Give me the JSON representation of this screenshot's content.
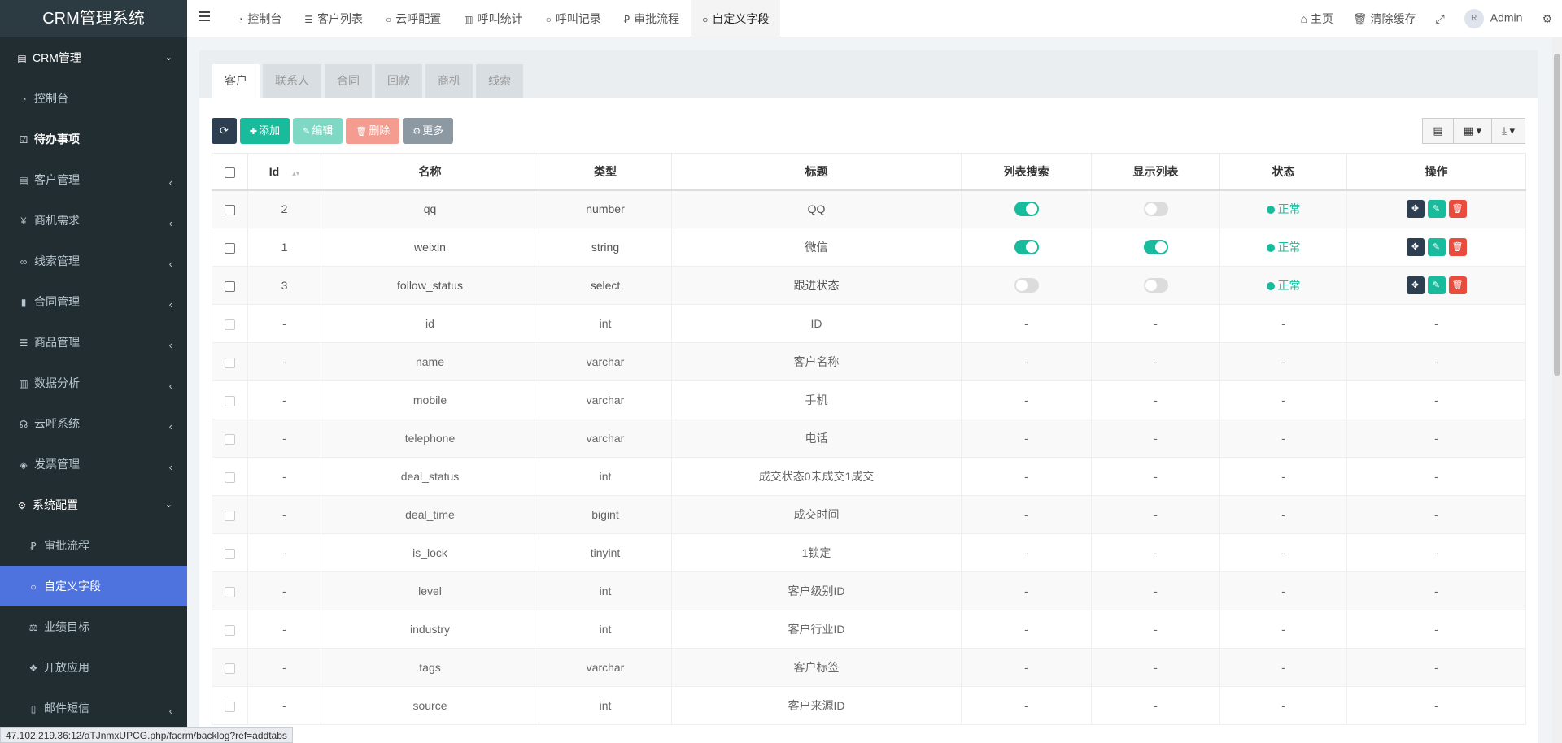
{
  "app": {
    "title": "CRM管理系统"
  },
  "sidebar": {
    "items": [
      {
        "label": "CRM管理",
        "type": "group",
        "icon": "id-card-icon",
        "glyph": "▤",
        "arrow": "⌄"
      },
      {
        "label": "控制台",
        "type": "item",
        "icon": "dashboard-icon",
        "glyph": "◔"
      },
      {
        "label": "待办事项",
        "type": "item-bold",
        "icon": "calendar-check-icon",
        "glyph": "☑"
      },
      {
        "label": "客户管理",
        "type": "item",
        "icon": "address-card-icon",
        "glyph": "▤",
        "arrow": "‹"
      },
      {
        "label": "商机需求",
        "type": "item",
        "icon": "yen-icon",
        "glyph": "¥",
        "arrow": "‹"
      },
      {
        "label": "线索管理",
        "type": "item",
        "icon": "link-icon",
        "glyph": "∞",
        "arrow": "‹"
      },
      {
        "label": "合同管理",
        "type": "item",
        "icon": "bookmark-icon",
        "glyph": "▮",
        "arrow": "‹"
      },
      {
        "label": "商品管理",
        "type": "item",
        "icon": "list-icon",
        "glyph": "☰",
        "arrow": "‹"
      },
      {
        "label": "数据分析",
        "type": "item",
        "icon": "bar-chart-icon",
        "glyph": "▥",
        "arrow": "‹"
      },
      {
        "label": "云呼系统",
        "type": "item",
        "icon": "headphones-icon",
        "glyph": "☊",
        "arrow": "‹"
      },
      {
        "label": "发票管理",
        "type": "item",
        "icon": "tag-icon",
        "glyph": "◈",
        "arrow": "‹"
      },
      {
        "label": "系统配置",
        "type": "group-bold",
        "icon": "cogs-icon",
        "glyph": "⚙",
        "arrow": "⌄"
      },
      {
        "label": "审批流程",
        "type": "sub",
        "icon": "flow-icon",
        "glyph": "Ꝑ"
      },
      {
        "label": "自定义字段",
        "type": "sub-active",
        "icon": "circle-icon",
        "glyph": "○"
      },
      {
        "label": "业绩目标",
        "type": "sub",
        "icon": "balance-scale-icon",
        "glyph": "⚖"
      },
      {
        "label": "开放应用",
        "type": "sub",
        "icon": "cubes-icon",
        "glyph": "❖"
      },
      {
        "label": "邮件短信",
        "type": "sub",
        "icon": "columns-icon",
        "glyph": "▯",
        "arrow": "‹"
      }
    ]
  },
  "topbar": {
    "tabs": [
      {
        "label": "控制台",
        "icon": "dashboard-icon",
        "glyph": "◔"
      },
      {
        "label": "客户列表",
        "icon": "list-icon",
        "glyph": "☰"
      },
      {
        "label": "云呼配置",
        "icon": "circle-icon",
        "glyph": "○"
      },
      {
        "label": "呼叫统计",
        "icon": "bar-chart-icon",
        "glyph": "▥"
      },
      {
        "label": "呼叫记录",
        "icon": "circle-icon",
        "glyph": "○"
      },
      {
        "label": "审批流程",
        "icon": "flow-icon",
        "glyph": "Ꝑ"
      },
      {
        "label": "自定义字段",
        "icon": "circle-icon",
        "glyph": "○",
        "active": true
      }
    ],
    "home_label": "主页",
    "clear_cache_label": "清除缓存",
    "user_name": "Admin",
    "avatar_text": "R"
  },
  "subtabs": [
    "客户",
    "联系人",
    "合同",
    "回款",
    "商机",
    "线索"
  ],
  "toolbar": {
    "add_label": "添加",
    "edit_label": "编辑",
    "delete_label": "删除",
    "more_label": "更多"
  },
  "table": {
    "headers": [
      "Id",
      "名称",
      "类型",
      "标题",
      "列表搜索",
      "显示列表",
      "状态",
      "操作"
    ],
    "custom_rows": [
      {
        "id": "2",
        "name": "qq",
        "type": "number",
        "title": "QQ",
        "search": true,
        "show": false,
        "status": "正常"
      },
      {
        "id": "1",
        "name": "weixin",
        "type": "string",
        "title": "微信",
        "search": true,
        "show": true,
        "status": "正常"
      },
      {
        "id": "3",
        "name": "follow_status",
        "type": "select",
        "title": "跟进状态",
        "search": false,
        "show": false,
        "status": "正常"
      }
    ],
    "system_rows": [
      {
        "id": "-",
        "name": "id",
        "type": "int",
        "title": "ID",
        "search": "-",
        "show": "-",
        "status": "-",
        "ops": "-"
      },
      {
        "id": "-",
        "name": "name",
        "type": "varchar",
        "title": "客户名称",
        "search": "-",
        "show": "-",
        "status": "-",
        "ops": "-"
      },
      {
        "id": "-",
        "name": "mobile",
        "type": "varchar",
        "title": "手机",
        "search": "-",
        "show": "-",
        "status": "-",
        "ops": "-"
      },
      {
        "id": "-",
        "name": "telephone",
        "type": "varchar",
        "title": "电话",
        "search": "-",
        "show": "-",
        "status": "-",
        "ops": "-"
      },
      {
        "id": "-",
        "name": "deal_status",
        "type": "int",
        "title": "成交状态0未成交1成交",
        "search": "-",
        "show": "-",
        "status": "-",
        "ops": "-"
      },
      {
        "id": "-",
        "name": "deal_time",
        "type": "bigint",
        "title": "成交时间",
        "search": "-",
        "show": "-",
        "status": "-",
        "ops": "-"
      },
      {
        "id": "-",
        "name": "is_lock",
        "type": "tinyint",
        "title": "1锁定",
        "search": "-",
        "show": "-",
        "status": "-",
        "ops": "-"
      },
      {
        "id": "-",
        "name": "level",
        "type": "int",
        "title": "客户级别ID",
        "search": "-",
        "show": "-",
        "status": "-",
        "ops": "-"
      },
      {
        "id": "-",
        "name": "industry",
        "type": "int",
        "title": "客户行业ID",
        "search": "-",
        "show": "-",
        "status": "-",
        "ops": "-"
      },
      {
        "id": "-",
        "name": "tags",
        "type": "varchar",
        "title": "客户标签",
        "search": "-",
        "show": "-",
        "status": "-",
        "ops": "-"
      },
      {
        "id": "-",
        "name": "source",
        "type": "int",
        "title": "客户来源ID",
        "search": "-",
        "show": "-",
        "status": "-",
        "ops": "-"
      }
    ]
  },
  "status_url": "47.102.219.36:12/aTJnmxUPCG.php/facrm/backlog?ref=addtabs",
  "colors": {
    "sidebar_bg": "#222d32",
    "active_item": "#4e73df",
    "success": "#18bc9c",
    "danger": "#e74c3c",
    "dark": "#2c3e50"
  }
}
